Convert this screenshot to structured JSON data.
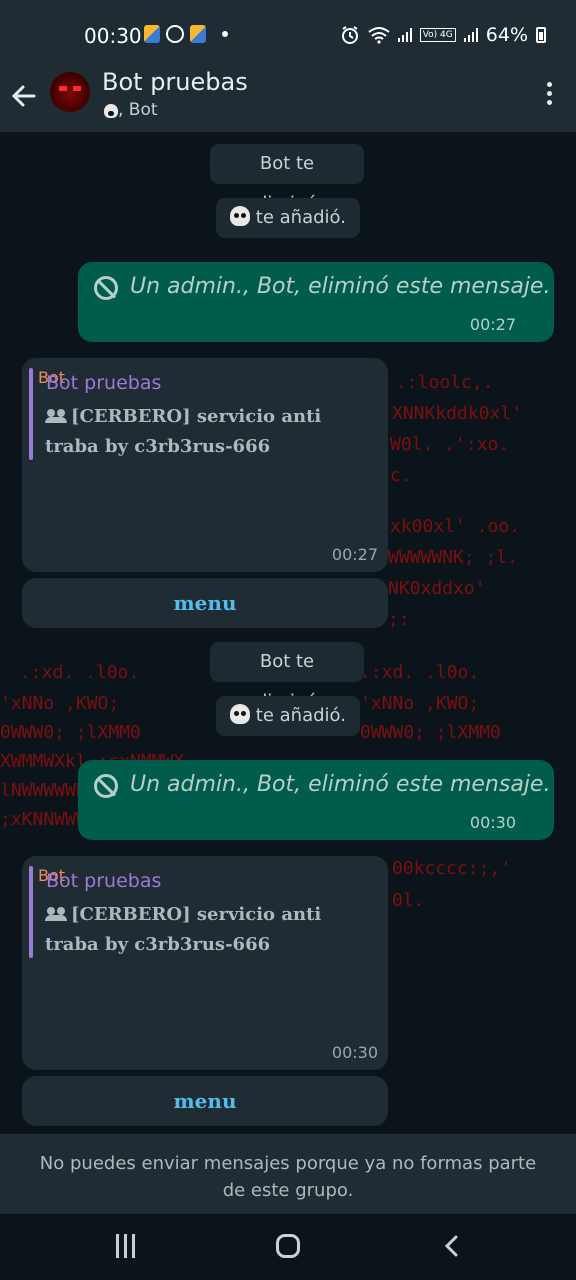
{
  "status_bar": {
    "time": "00:30",
    "battery": "64%",
    "network": "Vo) 4G",
    "icons": [
      "app-icon",
      "whatsapp-icon",
      "app-icon",
      "notification-dot",
      "alarm-icon",
      "wifi-icon",
      "signal-icon",
      "signal-icon",
      "battery-icon"
    ]
  },
  "header": {
    "title": "Bot pruebas",
    "subtitle": ", Bot",
    "icons": [
      "back-arrow-icon",
      "group-avatar",
      "skull-icon",
      "more-options-icon"
    ]
  },
  "messages": [
    {
      "type": "system",
      "text": "Bot te eliminó."
    },
    {
      "type": "system",
      "text": "te añadió."
    },
    {
      "type": "outgoing_deleted",
      "text": "Un admin., Bot, eliminó este mensaje.",
      "time": "00:27"
    },
    {
      "type": "incoming",
      "sender": "Bot",
      "quote_title": "Bot pruebas",
      "quote_body": "[CERBERO] servicio anti traba by c3rb3rus-666",
      "time": "00:27",
      "button": "menu"
    },
    {
      "type": "system",
      "text": "Bot te eliminó."
    },
    {
      "type": "system",
      "text": "te añadió."
    },
    {
      "type": "outgoing_deleted",
      "text": "Un admin., Bot, eliminó este mensaje.",
      "time": "00:30"
    },
    {
      "type": "incoming",
      "sender": "Bot",
      "quote_title": "Bot pruebas",
      "quote_body": "[CERBERO] servicio anti traba by c3rb3rus-666",
      "time": "00:30",
      "button": "menu"
    }
  ],
  "footer": {
    "line1": "No puedes enviar mensajes porque ya no formas parte",
    "line2": "de este grupo."
  },
  "wallpaper": {
    "rows": [
      ".:loolc,.",
      "XNNKkddk0xl'",
      "W0l.    .':xo.",
      "c.",
      "xk00xl'   .oo.",
      "WWWWWNK;   ;l.",
      "NK0xddxo'",
      ";:",
      ".:xd.    .l0o.",
      "'xNNo     ,KWO;",
      "0WWW0;    ;lXMM0",
      "XWMMWXkl,;cxNMMWX",
      "lNWWWWWKxc;'.",
      ";xKNNWWWWWWNXXk0oc.",
      "00kcccc:;,'",
      "0l."
    ],
    "colors": {
      "red": "#8a0f0f"
    }
  },
  "nav": {
    "icons": [
      "recent-apps-icon",
      "home-icon",
      "nav-back-icon"
    ]
  }
}
